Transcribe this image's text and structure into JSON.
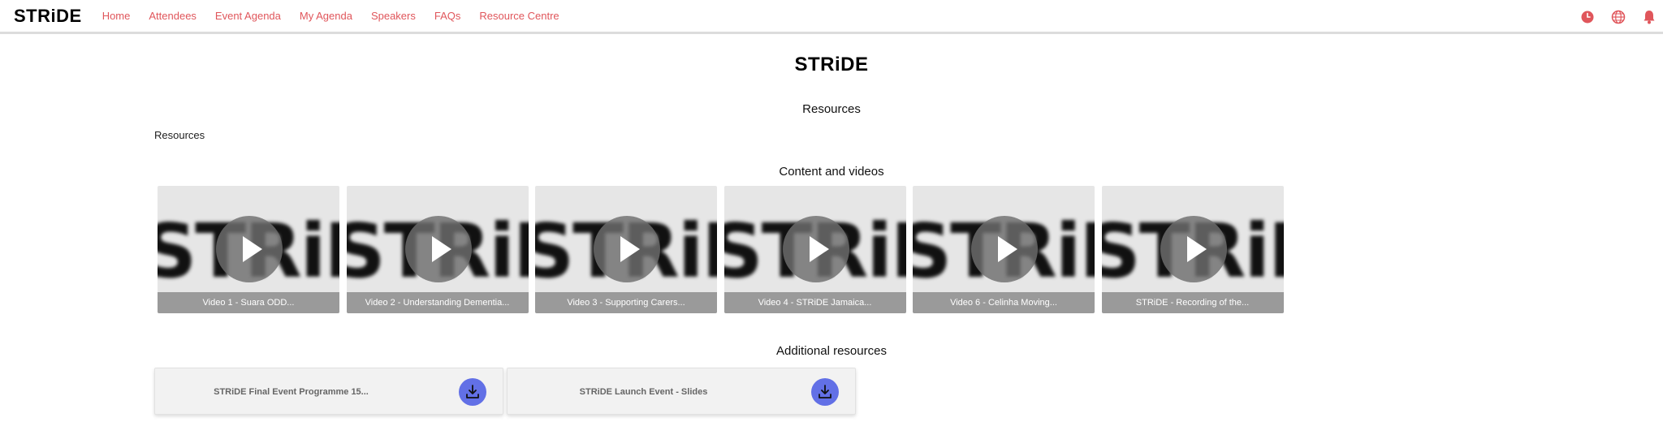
{
  "brand": "STRiDE",
  "nav": [
    "Home",
    "Attendees",
    "Event Agenda",
    "My Agenda",
    "Speakers",
    "FAQs",
    "Resource Centre"
  ],
  "icons": {
    "clock": "clock-icon",
    "globe": "globe-icon",
    "bell": "bell-icon"
  },
  "colors": {
    "accent": "#e0565b",
    "download": "#6270e6"
  },
  "page": {
    "logo": "STRiDE",
    "title": "Resources",
    "breadcrumb": "Resources",
    "videos_title": "Content and videos",
    "additional_title": "Additional resources"
  },
  "videos": [
    {
      "thumb": "STRiDE",
      "caption": "Video 1 - Suara ODD..."
    },
    {
      "thumb": "STRiDE",
      "caption": "Video 2 - Understanding Dementia..."
    },
    {
      "thumb": "STRiDE",
      "caption": "Video 3 - Supporting Carers..."
    },
    {
      "thumb": "STRiDE",
      "caption": "Video 4 - STRiDE Jamaica..."
    },
    {
      "thumb": "STRiDE",
      "caption": "Video 6 - Celinha Moving..."
    },
    {
      "thumb": "STRiDE",
      "caption": "STRiDE - Recording of the..."
    }
  ],
  "resources": [
    {
      "label": "STRiDE Final Event Programme 15..."
    },
    {
      "label": "STRiDE Launch Event - Slides"
    }
  ]
}
